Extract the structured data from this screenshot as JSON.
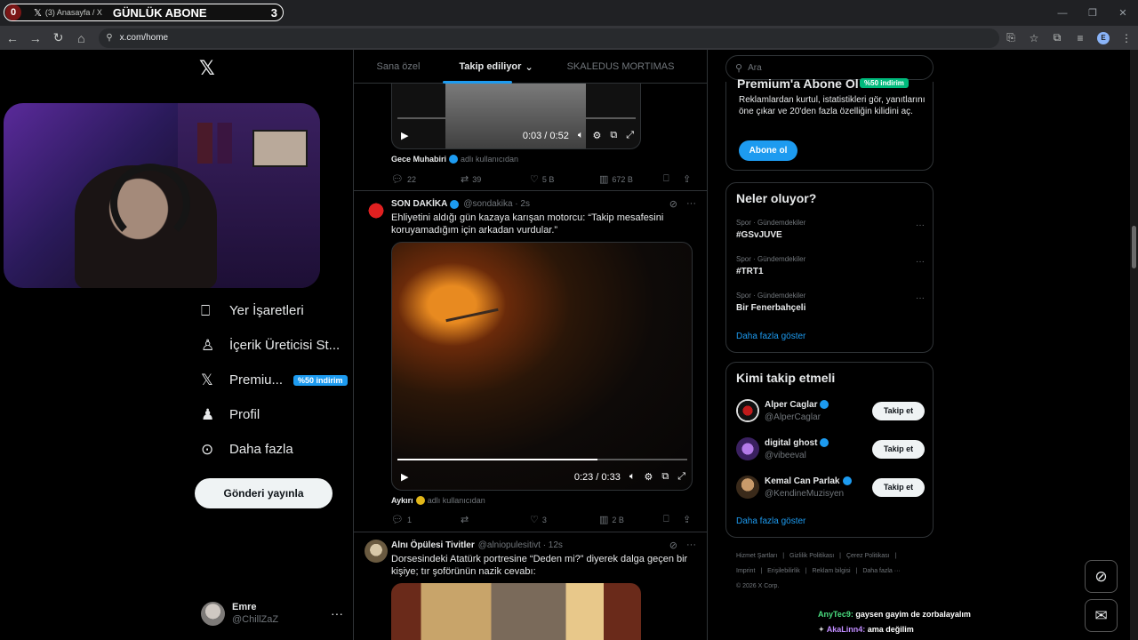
{
  "browser": {
    "tab_title": "(3) Anasayfa / X",
    "tab_x": "𝕏",
    "url": "x.com/home",
    "profile_initial": "E"
  },
  "overlay": {
    "count": "0",
    "label": "GÜNLÜK ABONE",
    "number": "3"
  },
  "sidebar": {
    "items": [
      {
        "label": "Yer İşaretleri",
        "icon": "bookmark-icon"
      },
      {
        "label": "İçerik Üreticisi St...",
        "icon": "creator-studio-icon"
      },
      {
        "label": "Premiu...",
        "icon": "x-premium-icon",
        "badge": "%50 indirim"
      },
      {
        "label": "Profil",
        "icon": "profile-icon"
      },
      {
        "label": "Daha fazla",
        "icon": "more-circle-icon"
      }
    ],
    "post_button": "Gönderi yayınla",
    "user": {
      "name": "Emre",
      "handle": "@ChillZaZ"
    }
  },
  "feed": {
    "tabs": [
      "Sana özel",
      "Takip ediliyor",
      "SKALEDUS MORTIMAS"
    ],
    "tweet1": {
      "video_time": "0:03 / 0:52",
      "video_progress": 0,
      "source_name": "Gece Muhabiri",
      "source_sub": "adlı kullanıcıdan",
      "replies": "22",
      "retweets": "39",
      "likes": "5 B",
      "views": "672 B"
    },
    "tweet2": {
      "name": "SON DAKİKA",
      "handle": "@sondakika · 2s",
      "text": "Ehliyetini aldığı gün kazaya karışan motorcu:  “Takip mesafesini koruyamadığım için arkadan vurdular.”",
      "video_time": "0:23 / 0:33",
      "video_progress": 0.69,
      "source_name": "Aykırı",
      "source_sub": "adlı kullanıcıdan",
      "replies": "1",
      "retweets": "",
      "likes": "3",
      "views": "2 B"
    },
    "tweet3": {
      "name": "Alnı Öpülesi Tivitler",
      "handle": "@alniopulesitivt · 12s",
      "text": "Dorsesindeki Atatürk portresine “Deden mi?” diyerek dalga geçen bir kişiye; tır şoförünün nazik cevabı:"
    }
  },
  "right": {
    "search_placeholder": "Ara",
    "premium": {
      "title": "Premium'a Abone Ol",
      "badge": "%50 indirim",
      "desc": "Reklamlardan kurtul, istatistikleri gör, yanıtlarını öne çıkar ve 20'den fazla özelliğin kilidini aç.",
      "button": "Abone ol"
    },
    "trends": {
      "title": "Neler oluyor?",
      "items": [
        {
          "category": "Spor · Gündemdekiler",
          "name": "#GSvJUVE"
        },
        {
          "category": "Spor · Gündemdekiler",
          "name": "#TRT1"
        },
        {
          "category": "Spor · Gündemdekiler",
          "name": "Bir Fenerbahçeli"
        }
      ],
      "show_more": "Daha fazla göster"
    },
    "who_to_follow": {
      "title": "Kimi takip etmeli",
      "items": [
        {
          "name": "Alper Caglar",
          "handle": "@AlperCaglar",
          "button": "Takip et"
        },
        {
          "name": "digital ghost",
          "handle": "@vibeeval",
          "button": "Takip et"
        },
        {
          "name": "Kemal Can Parlak",
          "handle": "@KendineMuzisyen",
          "button": "Takip et"
        }
      ],
      "show_more": "Daha fazla göster"
    },
    "footer": {
      "links": [
        "Hizmet Şartları",
        "|",
        "Gizlilik Politikası",
        "|",
        "Çerez Politikası",
        "|",
        "Imprint",
        "|",
        "Erişilebilirlik",
        "|",
        "Reklam bilgisi",
        "|",
        "Daha fazla ···"
      ],
      "copyright": "© 2026 X Corp."
    }
  },
  "chat": [
    {
      "user": "AnyTec9:",
      "message": "gaysen gayim de zorbalayalım"
    },
    {
      "user": "AkaLinn4:",
      "message": "ama değilim"
    }
  ],
  "colors": {
    "accent": "#1d9bf0",
    "background": "#000000",
    "border": "#2f3336"
  }
}
